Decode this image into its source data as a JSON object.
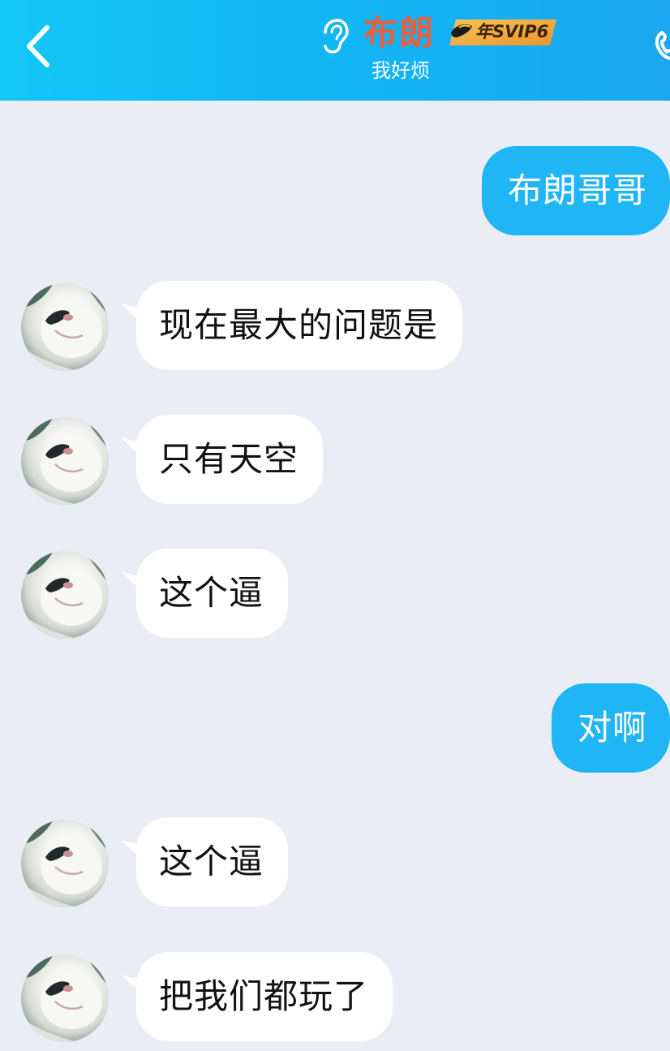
{
  "header": {
    "contact_name": "布朗",
    "svip_label": "年SVIP6",
    "status": "我好烦",
    "icons": {
      "back": "chevron-left-icon",
      "ear": "ear-icon",
      "call": "phone-icon"
    },
    "colors": {
      "header_bg": "#14c6f6",
      "name": "#e8603f",
      "badge": "#f2a93a"
    }
  },
  "messages": [
    {
      "side": "out",
      "text": "布朗哥哥"
    },
    {
      "side": "in",
      "text": "现在最大的问题是"
    },
    {
      "side": "in",
      "text": "只有天空"
    },
    {
      "side": "in",
      "text": "这个逼"
    },
    {
      "side": "out",
      "text": "对啊"
    },
    {
      "side": "in",
      "text": "这个逼"
    },
    {
      "side": "in",
      "text": "把我们都玩了"
    }
  ],
  "colors": {
    "chat_bg": "#eaedf4",
    "incoming_bubble": "#ffffff",
    "outgoing_bubble": "#20b5f5"
  }
}
